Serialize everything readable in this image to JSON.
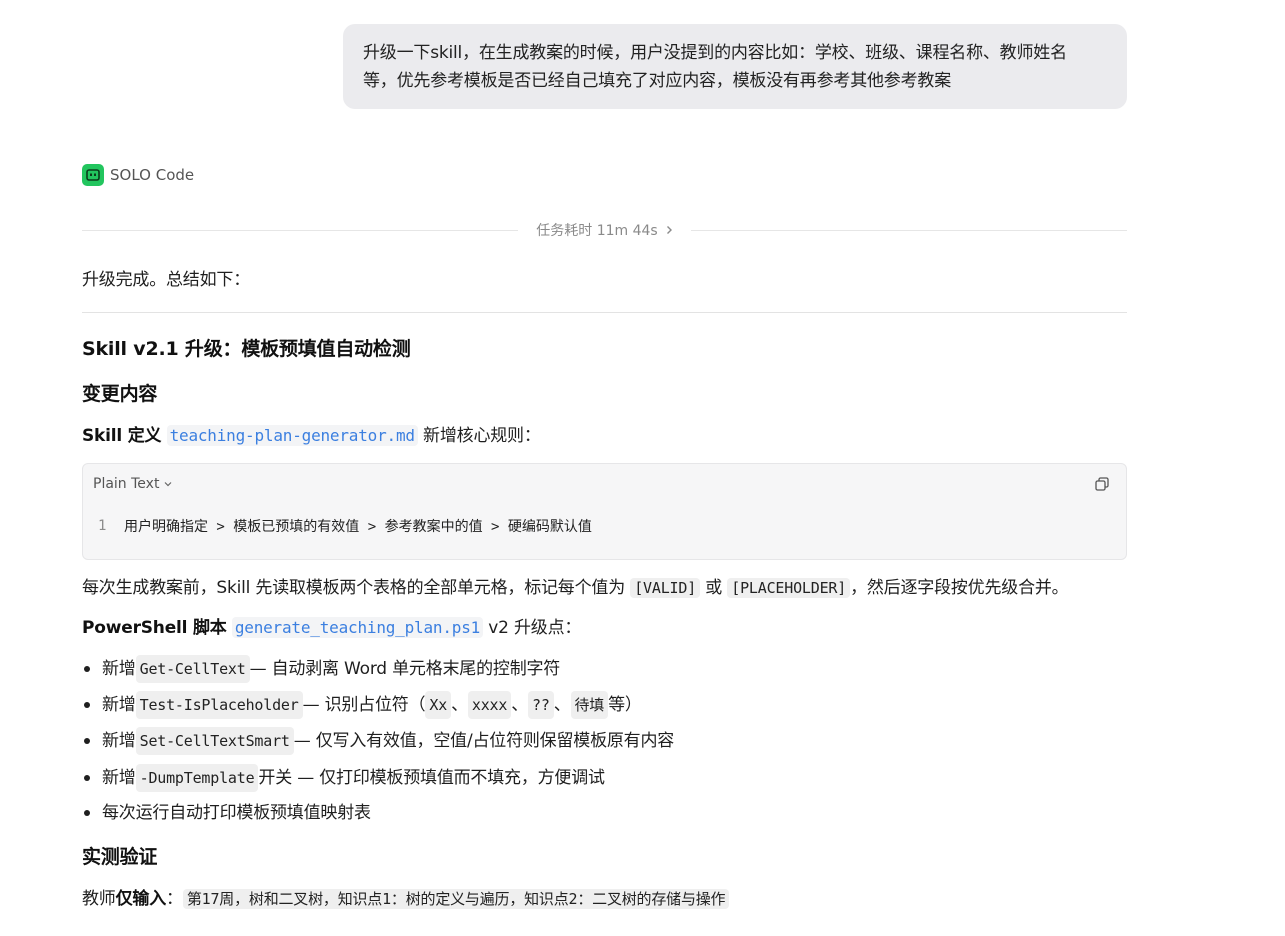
{
  "user_message": {
    "line1": "升级一下skill，在生成教案的时候，用户没提到的内容比如：学校、班级、课程名称、教师姓名",
    "line2": "等，优先参考模板是否已经自己填充了对应内容，模板没有再参考其他参考教案"
  },
  "assistant": {
    "name": "SOLO Code",
    "avatar_icon": "robot-icon",
    "accent_color": "#22c55e"
  },
  "duration": {
    "label": "任务耗时 11m 44s"
  },
  "reply": {
    "intro": "升级完成。总结如下：",
    "title": "Skill v2.1 升级：模板预填值自动检测",
    "section_changes": "变更内容",
    "skill_def": {
      "prefix_plain": "Skill ",
      "prefix_bold": "定义",
      "file": "teaching-plan-generator.md",
      "suffix": " 新增核心规则："
    },
    "code_block": {
      "language": "Plain Text",
      "line_number": "1",
      "line": "用户明确指定 > 模板已预填的有效值 > 参考教案中的值 > 硬编码默认值"
    },
    "desc": {
      "a": "每次生成教案前，Skill 先读取模板两个表格的全部单元格，标记每个值为 ",
      "tag_valid": "[VALID]",
      "b": " 或 ",
      "tag_placeholder": "[PLACEHOLDER]",
      "c": "，然后逐字段按优先级合并。"
    },
    "ps": {
      "prefix": "PowerShell 脚本",
      "file": "generate_teaching_plan.ps1",
      "suffix": " v2 升级点："
    },
    "bullets": [
      {
        "pre": "新增 ",
        "code": "Get-CellText",
        "post": " — 自动剥离 Word 单元格末尾的控制字符"
      },
      {
        "pre": "新增 ",
        "code": "Test-IsPlaceholder",
        "post": " — 识别占位符（"
      },
      {
        "pre": "新增 ",
        "code": "Set-CellTextSmart",
        "post": " — 仅写入有效值，空值/占位符则保留模板原有内容"
      },
      {
        "pre": "新增 ",
        "code": "-DumpTemplate",
        "post": " 开关 — 仅打印模板预填值而不填充，方便调试"
      },
      {
        "text": "每次运行自动打印模板预填值映射表"
      }
    ],
    "placeholder_examples": [
      "Xx",
      "xxxx",
      "??",
      "待填"
    ],
    "placeholder_sep": "、",
    "placeholder_end": " 等）",
    "section_verify": "实测验证",
    "teacher_input": {
      "pre": "教师",
      "bold": "仅输入",
      "colon": "：",
      "code": "第17周，树和二叉树，知识点1：树的定义与遍历，知识点2：二叉树的存储与操作"
    }
  }
}
